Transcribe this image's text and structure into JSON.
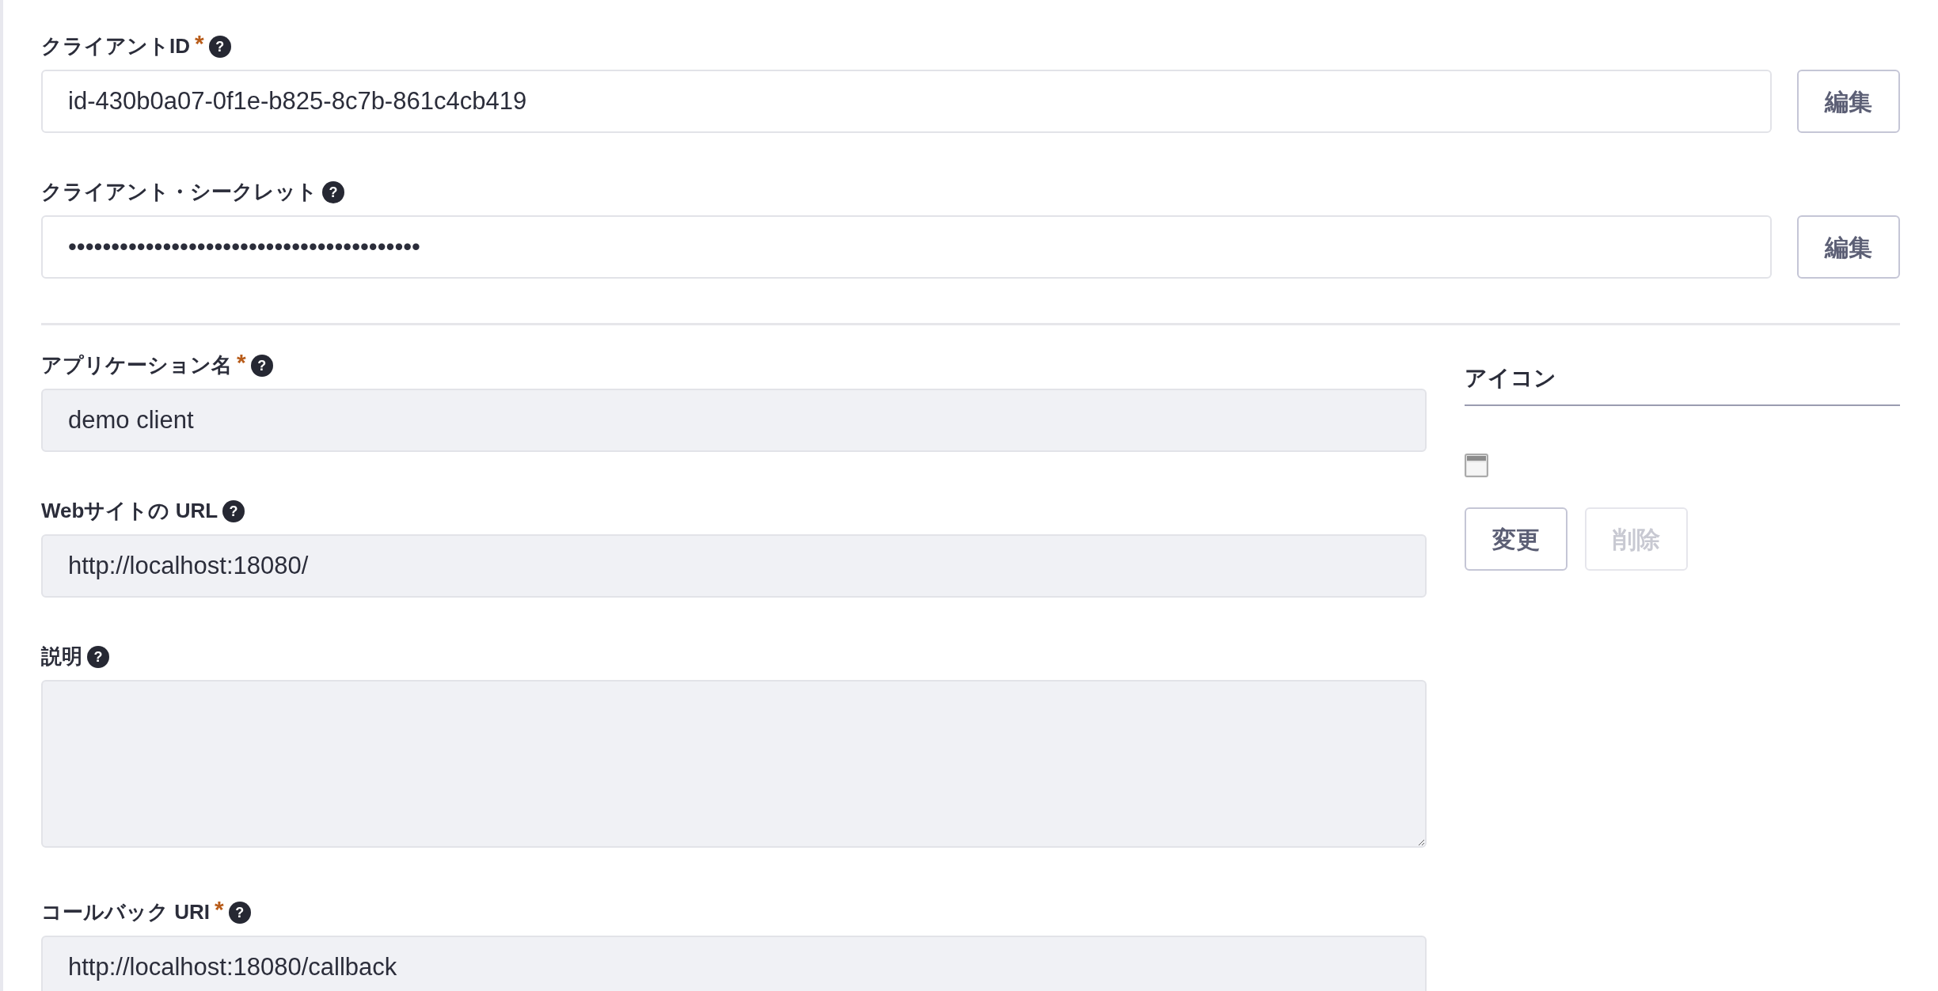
{
  "credentials": [
    {
      "label": "クライアントID",
      "required_mark": "*",
      "help_mark": "?",
      "value": "id-430b0a07-0f1e-b825-8c7b-861c4cb419",
      "disabled": false,
      "button": "編集"
    },
    {
      "label": "クライアント・シークレット",
      "help_mark": "?",
      "value": "•••••••••••••••••••••••••••••••••••••••••",
      "disabled": false,
      "button": "編集"
    }
  ],
  "fields": [
    {
      "kind": "input",
      "label": "アプリケーション名",
      "required_mark": "*",
      "help_mark": "?",
      "value": "demo client",
      "disabled": true
    },
    {
      "kind": "input",
      "label": "Webサイトの URL",
      "help_mark": "?",
      "value": "http://localhost:18080/",
      "disabled": true
    },
    {
      "kind": "textarea",
      "label": "説明",
      "help_mark": "?",
      "disabled": true
    },
    {
      "kind": "textarea",
      "label": "コールバック URI",
      "required_mark": "*",
      "help_mark": "?",
      "value": "http://localhost:18080/callback",
      "disabled": true
    }
  ],
  "icon_panel": {
    "title": "アイコン",
    "buttons": [
      {
        "label": "変更",
        "disabled": false
      },
      {
        "label": "削除",
        "disabled": true
      }
    ]
  }
}
